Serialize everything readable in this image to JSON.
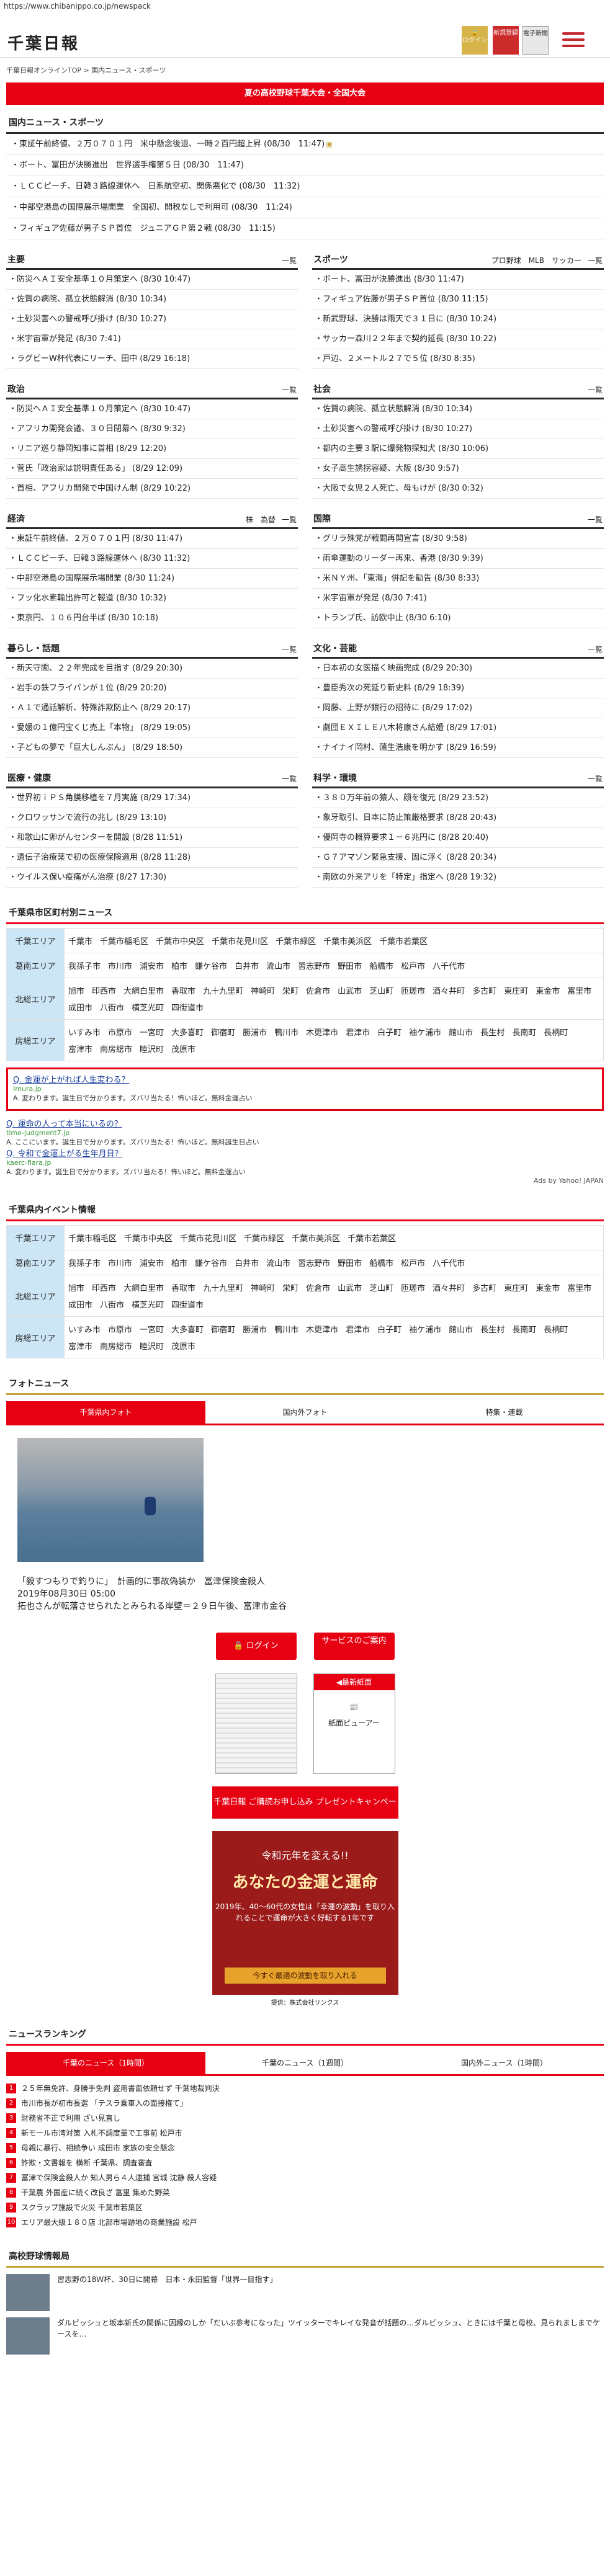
{
  "url": "https://www.chibanippo.co.jp/newspack",
  "header": {
    "logo": "千葉日報",
    "login": "ログイン",
    "register": "新規登録",
    "paper": "電子新聞"
  },
  "breadcrumb": "千葉日報オンラインTOP > 国内ニュース・スポーツ",
  "banner": "夏の高校野球千葉大会・全国大会",
  "sections": {
    "domestic_title": "国内ニュース・スポーツ",
    "domestic": [
      "東証午前終値、２万０７０１円　米中懸念後退、一時２百円超上昇 (08/30　11:47)",
      "ボート、冨田が決勝進出　世界選手権第５日 (08/30　11:47)",
      "ＬＣＣピーチ、日韓３路線運休へ　日系航空初、関係悪化で (08/30　11:32)",
      "中部空港島の国際展示場開業　全国初、開税なしで利用可 (08/30　11:24)",
      "フィギュア佐藤が男子ＳＰ首位　ジュニアＧＰ第２戦 (08/30　11:15)"
    ]
  },
  "columns": [
    {
      "title": "主要",
      "more": "一覧",
      "items": [
        "防災へＡＩ安全基準１０月策定へ (8/30 10:47)",
        "佐賀の病院、孤立状態解消 (8/30 10:34)",
        "土砂災害への警戒呼び掛け (8/30 10:27)",
        "米宇宙軍が発足 (8/30 7:41)",
        "ラグビーW杯代表にリーチ、田中 (8/29 16:18)"
      ]
    },
    {
      "title": "スポーツ",
      "more": "一覧",
      "sub": "プロ野球　MLB　サッカー",
      "items": [
        "ボート、冨田が決勝進出 (8/30 11:47)",
        "フィギュア佐藤が男子ＳＰ首位 (8/30 11:15)",
        "新武野球、決勝は雨天で３１日に (8/30 10:24)",
        "サッカー森川２２年まで契約延長 (8/30 10:22)",
        "戸辺、２メートル２７で５位 (8/30 8:35)"
      ]
    },
    {
      "title": "政治",
      "more": "一覧",
      "items": [
        "防災へＡＩ安全基準１０月策定へ (8/30 10:47)",
        "アフリカ開発会議、３０日閉幕へ (8/30 9:32)",
        "リニア巡り静岡知事に首相 (8/29 12:20)",
        "菅氏「政治家は説明責任ある」 (8/29 12:09)",
        "首相、アフリカ開発で中国けん制 (8/29 10:22)"
      ]
    },
    {
      "title": "社会",
      "more": "一覧",
      "items": [
        "佐賀の病院、孤立状態解消 (8/30 10:34)",
        "土砂災害への警戒呼び掛け (8/30 10:27)",
        "都内の主要３駅に爆発物探知犬 (8/30 10:06)",
        "女子高生誘拐容疑、大阪 (8/30 9:57)",
        "大阪で女児２人死亡、母もけが (8/30 0:32)"
      ]
    },
    {
      "title": "経済",
      "more": "一覧",
      "sub": "株　為替",
      "items": [
        "東証午前終値、２万０７０１円 (8/30 11:47)",
        "ＬＣＣピーチ、日韓３路線運休へ (8/30 11:32)",
        "中部空港島の国際展示場開業 (8/30 11:24)",
        "フッ化水素輸出許可と報道 (8/30 10:32)",
        "東京円、１０６円台半ば (8/30 10:18)"
      ]
    },
    {
      "title": "国際",
      "more": "一覧",
      "items": [
        "グリラ殊党が戦闘再開宣言 (8/30 9:58)",
        "雨傘運動のリーダー再来、香港 (8/30 9:39)",
        "米ＮＹ州、「東海」併記を勧告 (8/30 8:33)",
        "米宇宙軍が発足 (8/30 7:41)",
        "トランプ氏、訪欧中止 (8/30 6:10)"
      ]
    },
    {
      "title": "暮らし・話題",
      "more": "一覧",
      "items": [
        "新天守閣、２２年完成を目指す (8/29 20:30)",
        "岩手の鉄フライパンが１位 (8/29 20:20)",
        "Ａ１で通話解析、特殊詐欺防止へ (8/29 20:17)",
        "愛媛の１億円宝くじ売上「本物」 (8/29 19:05)",
        "子どもの夢で「巨大しんぶん」 (8/29 18:50)"
      ]
    },
    {
      "title": "文化・芸能",
      "more": "一覧",
      "items": [
        "日本初の女医描く映画完成 (8/29 20:30)",
        "豊臣秀次の死延り新史料 (8/29 18:39)",
        "岡藤、上野が銀行の招待に (8/29 17:02)",
        "劇団ＥＸＩＬＥ八木将康さん結婚 (8/29 17:01)",
        "ナイナイ岡村、蒲生浩康を明かす (8/29 16:59)"
      ]
    },
    {
      "title": "医療・健康",
      "more": "一覧",
      "items": [
        "世界初ｉＰＳ角膜移植を７月実施 (8/29 17:34)",
        "クロワッサンで流行の兆し (8/29 13:10)",
        "和歌山に卵がんセンターを開設 (8/28 11:51)",
        "遺伝子治療薬で初の医療保険適用 (8/28 11:28)",
        "ウイルス保い疫痛がん治療 (8/27 17:30)"
      ]
    },
    {
      "title": "科学・環境",
      "more": "一覧",
      "items": [
        "３８０万年前の猿人、顔を復元 (8/29 23:52)",
        "象牙取引、日本に防止策厳格要求 (8/28 20:43)",
        "優岡寺の概算要求１－６兆円に (8/28 20:40)",
        "Ｇ７アマゾン緊急支援、固に浮く (8/28 20:34)",
        "南欧の外来アリを「特定」指定へ (8/28 19:32)"
      ]
    }
  ],
  "areas": {
    "title": "千葉県市区町村別ニュース",
    "rows": [
      {
        "label": "千葉エリア",
        "cities": [
          "千葉市",
          "千葉市稲毛区",
          "千葉市中央区",
          "千葉市花見川区",
          "千葉市緑区",
          "千葉市美浜区",
          "千葉市若葉区"
        ]
      },
      {
        "label": "葛南エリア",
        "cities": [
          "我孫子市",
          "市川市",
          "浦安市",
          "柏市",
          "鎌ケ谷市",
          "白井市",
          "流山市",
          "習志野市",
          "野田市",
          "船橋市",
          "松戸市",
          "八千代市"
        ]
      },
      {
        "label": "北総エリア",
        "cities": [
          "旭市",
          "印西市",
          "大網白里市",
          "香取市",
          "九十九里町",
          "神崎町",
          "栄町",
          "佐倉市",
          "山武市",
          "芝山町",
          "匝瑳市",
          "酒々井町",
          "多古町",
          "東庄町",
          "東金市",
          "富里市",
          "成田市",
          "八街市",
          "横芝光町",
          "四街道市"
        ]
      },
      {
        "label": "房総エリア",
        "cities": [
          "いすみ市",
          "市原市",
          "一宮町",
          "大多喜町",
          "御宿町",
          "勝浦市",
          "鴨川市",
          "木更津市",
          "君津市",
          "白子町",
          "袖ケ浦市",
          "館山市",
          "長生村",
          "長南町",
          "長柄町",
          "富津市",
          "南房総市",
          "睦沢町",
          "茂原市"
        ]
      }
    ]
  },
  "ads": [
    {
      "q": "Q. 金運が上がれば人生変わる？",
      "u": "Imura.jp",
      "a": "A. 変わります。誕生日で分かります。ズバリ当たる！怖いほど。無料金運占い"
    },
    {
      "q": "Q. 運命の人って本当にいるの？",
      "u": "time-judgment7.jp",
      "a": "A. ここにいます。誕生日で分かります。ズバリ当たる！怖いほど。無料誕生日占い"
    },
    {
      "q": "Q. 令和で金運上がる生年月日？",
      "u": "kaerc-flara.jp",
      "a": "A. 変わります。誕生日で分かります。ズバリ当たる！怖いほど。無料金運占い"
    }
  ],
  "ads_by": "Ads by Yahoo! JAPAN",
  "events": {
    "title": "千葉県内イベント情報",
    "rows": [
      {
        "label": "千葉エリア",
        "cities": [
          "千葉市稲毛区",
          "千葉市中央区",
          "千葉市花見川区",
          "千葉市緑区",
          "千葉市美浜区",
          "千葉市若葉区"
        ]
      },
      {
        "label": "葛南エリア",
        "cities": [
          "我孫子市",
          "市川市",
          "浦安市",
          "柏市",
          "鎌ケ谷市",
          "白井市",
          "流山市",
          "習志野市",
          "野田市",
          "船橋市",
          "松戸市",
          "八千代市"
        ]
      },
      {
        "label": "北総エリア",
        "cities": [
          "旭市",
          "印西市",
          "大網白里市",
          "香取市",
          "九十九里町",
          "神崎町",
          "栄町",
          "佐倉市",
          "山武市",
          "芝山町",
          "匝瑳市",
          "酒々井町",
          "多古町",
          "東庄町",
          "東金市",
          "富里市",
          "成田市",
          "八街市",
          "横芝光町",
          "四街道市"
        ]
      },
      {
        "label": "房総エリア",
        "cities": [
          "いすみ市",
          "市原市",
          "一宮町",
          "大多喜町",
          "御宿町",
          "勝浦市",
          "鴨川市",
          "木更津市",
          "君津市",
          "白子町",
          "袖ケ浦市",
          "館山市",
          "長生村",
          "長南町",
          "長柄町",
          "富津市",
          "南房総市",
          "睦沢町",
          "茂原市"
        ]
      }
    ]
  },
  "photo": {
    "title": "フォトニュース",
    "tabs": [
      "千葉県内フォト",
      "国内外フォト",
      "特集・連載"
    ],
    "caption1": "「殺すつもりで釣りに」　計画的に事故偽装か　冨津保険金殺人",
    "caption2": "2019年08月30日 05:00",
    "caption3": "拓也さんが転落させられたとみられる岸壁＝２９日午後、富津市金谷",
    "login_btn": "ログイン",
    "service_btn": "サービスのご案内",
    "latest": "◀最新紙面",
    "viewer": "紙面ビューアー"
  },
  "promo": {
    "top": "千葉日報 ご購読お申し込み プレゼントキャンペーン実施中！",
    "l1": "令和元年を変える!!",
    "l2": "あなたの金運と運命",
    "l3": "2019年、40〜60代の女性は「幸運の波動」を取り入れることで運命が大きく好転する1年です",
    "l4": "今すぐ最適の波動を取り入れる",
    "sponsor": "提供：株式会社リンクス"
  },
  "ranking": {
    "title": "ニュースランキング",
    "tabs": [
      "千葉のニュース（1時間）",
      "千葉のニュース（1週間）",
      "国内外ニュース（1時間）"
    ],
    "items": [
      "２５年無免許、身勝手免判 盗用書面依頼せず 千葉地裁判決",
      "市川市長が初市長選 「テスラ乗車入の面接権て」",
      "財務省不正で利用 ざい見直し",
      "新モール市湾対策 入札不調度量で工事前 松戸市",
      "母親に暴行、相続争い 成田市 家族の安全懸念",
      "詐欺・文書報を 横断 千葉県、調査審査",
      "冨津で保険金殺人か 知人男ら４人逮捕 宮城 沈静 殺人容疑",
      "千葉農 外国産に続く改良ざ 富里 集めた野菜",
      "スクラップ施設で火災 千葉市若葉区",
      "エリア最大級１８０店 北部市場跡地の商業施設 松戸"
    ]
  },
  "hs": {
    "title": "高校野球情報局",
    "items": [
      {
        "text": "習志野の18Ｗ杯、30日に開幕　日本・永田監督「世界一目指す」"
      },
      {
        "text": "ダルビッシュと坂本新氏の関係に因縁のしか「だいぶ参考になった」ツイッターでキレイな発音が話題の…ダルビッシュ、ときには千葉と母校、見られましまでケースを…"
      }
    ]
  }
}
